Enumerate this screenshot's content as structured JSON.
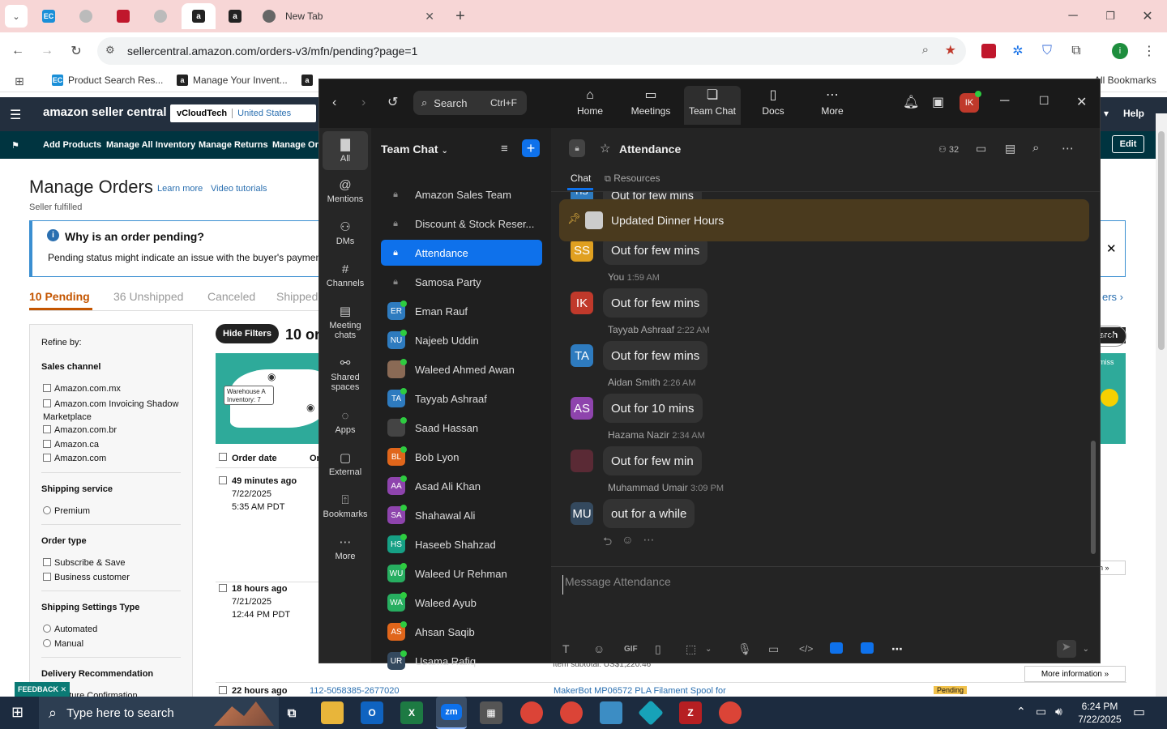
{
  "browser": {
    "tabs": [
      {
        "label": "EC"
      },
      {
        "label": ""
      },
      {
        "label": ""
      },
      {
        "label": ""
      },
      {
        "label": "a"
      },
      {
        "label": "a"
      },
      {
        "label": "New Tab"
      }
    ],
    "url": "sellercentral.amazon.com/orders-v3/mfn/pending?page=1",
    "bookmarks": [
      "Product Search Res...",
      "Manage Your Invent...",
      "All Bookmarks"
    ]
  },
  "seller": {
    "logo": "amazon seller central",
    "account": "vCloudTech",
    "region": "United States",
    "help": "Help",
    "nav": [
      "Add Products",
      "Manage All Inventory",
      "Manage Returns",
      "Manage Ord"
    ],
    "edit": "Edit",
    "page_title": "Manage Orders",
    "learn_more": "Learn more",
    "video_tutorials": "Video tutorials",
    "subtitle": "Seller fulfilled",
    "alert_title": "Why is an order pending?",
    "alert_body": "Pending status might indicate an issue with the buyer's payment m",
    "order_tabs": [
      "10 Pending",
      "36 Unshipped",
      "Canceled",
      "Shipped"
    ],
    "refine_by": "Refine by:",
    "sales_channel": "Sales channel",
    "channels": [
      "Amazon.com.mx",
      "Amazon.com Invoicing Shadow Marketplace",
      "Amazon.com.br",
      "Amazon.ca",
      "Amazon.com"
    ],
    "shipping_service": "Shipping service",
    "premium": "Premium",
    "order_type": "Order type",
    "order_types": [
      "Subscribe & Save",
      "Business customer"
    ],
    "shipping_settings": "Shipping Settings Type",
    "settings_types": [
      "Automated",
      "Manual"
    ],
    "delivery_rec": "Delivery Recommendation",
    "nature_conf": "nature Confirmation",
    "hide_filters": "Hide Filters",
    "count_title": "10 or",
    "map_label": "Warehouse A Inventory: 7",
    "col_order_date": "Order date",
    "col_or": "Or",
    "orders": [
      {
        "when": "49 minutes ago",
        "date": "7/22/2025",
        "time": "5:35 AM PDT"
      },
      {
        "when": "18 hours ago",
        "date": "7/21/2025",
        "time": "12:44 PM PDT"
      },
      {
        "when": "22 hours ago",
        "order_id": "112-5058385-2677020",
        "product": "MakerBot MP06572 PLA Filament Spool for",
        "status": "Pending"
      }
    ],
    "item_subtotal": "Item subtotal: US$1,220.46",
    "more_info": "More information",
    "right_more_info": "More information",
    "feedback": "FEEDBACK"
  },
  "zoom": {
    "search_label": "Search",
    "search_shortcut": "Ctrl+F",
    "nav": [
      "Home",
      "Meetings",
      "Team Chat",
      "Docs",
      "More"
    ],
    "avatar_initials": "IK",
    "left_nav": [
      "All",
      "Mentions",
      "DMs",
      "Channels",
      "Meeting chats",
      "Shared spaces",
      "Apps",
      "External",
      "Bookmarks",
      "More"
    ],
    "list_title": "Team Chat",
    "channels": [
      {
        "name": "Amazon Sales Team",
        "type": "lock"
      },
      {
        "name": "Discount & Stock Reser...",
        "type": "lock"
      },
      {
        "name": "Attendance",
        "type": "lock",
        "active": true
      },
      {
        "name": "Samosa Party",
        "type": "lock"
      },
      {
        "name": "Eman Rauf",
        "initials": "ER",
        "color": "#2e7bbf"
      },
      {
        "name": "Najeeb Uddin",
        "initials": "NU",
        "color": "#2e7bbf"
      },
      {
        "name": "Waleed Ahmed Awan",
        "initials": "",
        "color": "#8a6a55"
      },
      {
        "name": "Tayyab Ashraaf",
        "initials": "TA",
        "color": "#2e7bbf"
      },
      {
        "name": "Saad Hassan",
        "initials": "",
        "color": "#444"
      },
      {
        "name": "Bob Lyon",
        "initials": "BL",
        "color": "#e0661b"
      },
      {
        "name": "Asad Ali Khan",
        "initials": "AA",
        "color": "#8e44ad"
      },
      {
        "name": "Shahawal Ali",
        "initials": "SA",
        "color": "#8e44ad"
      },
      {
        "name": "Haseeb Shahzad",
        "initials": "HS",
        "color": "#16a085"
      },
      {
        "name": "Waleed Ur Rehman",
        "initials": "WU",
        "color": "#27ae60"
      },
      {
        "name": "Waleed Ayub",
        "initials": "WA",
        "color": "#27ae60"
      },
      {
        "name": "Ahsan Saqib",
        "initials": "AS",
        "color": "#e0661b"
      },
      {
        "name": "Usama Rafiq",
        "initials": "UR",
        "color": "#34495e"
      }
    ],
    "chat_title": "Attendance",
    "members": "32",
    "tabs": [
      "Chat",
      "Resources"
    ],
    "cut_message": "Out for few mins",
    "pinned": "Updated Dinner Hours",
    "messages": [
      {
        "initials": "SS",
        "color": "#e0a020",
        "name": "",
        "time": "",
        "text": "Out for few mins"
      },
      {
        "initials": "IK",
        "color": "#c0392b",
        "name": "You",
        "time": "1:59 AM",
        "text": "Out for few mins"
      },
      {
        "initials": "TA",
        "color": "#2e7bbf",
        "name": "Tayyab Ashraaf",
        "time": "2:22 AM",
        "text": "Out for few mins"
      },
      {
        "initials": "AS",
        "color": "#8e44ad",
        "name": "Aidan Smith",
        "time": "2:26 AM",
        "text": "Out for 10 mins"
      },
      {
        "initials": "",
        "color": "#5a2a35",
        "name": "Hazama Nazir",
        "time": "2:34 AM",
        "text": "Out for few min"
      },
      {
        "initials": "MU",
        "color": "#34495e",
        "name": "Muhammad Umair",
        "time": "3:09 PM",
        "text": "out for a while"
      }
    ],
    "composer_placeholder": "Message Attendance"
  },
  "taskbar": {
    "search_placeholder": "Type here to search",
    "time": "6:24 PM",
    "date": "7/22/2025"
  }
}
